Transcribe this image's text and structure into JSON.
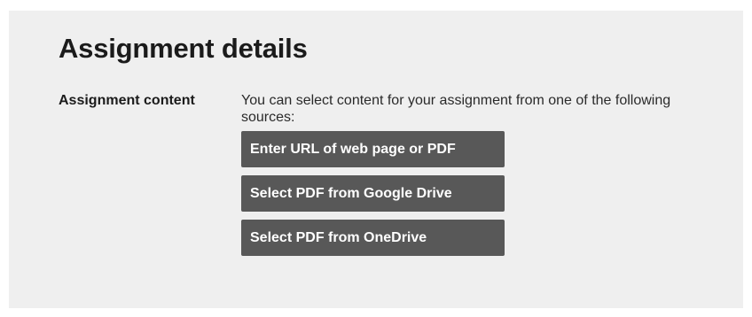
{
  "page": {
    "title": "Assignment details"
  },
  "assignment_content": {
    "label": "Assignment content",
    "description": "You can select content for your assignment from one of the following sources:",
    "buttons": [
      {
        "label": "Enter URL of web page or PDF"
      },
      {
        "label": "Select PDF from Google Drive"
      },
      {
        "label": "Select PDF from OneDrive"
      }
    ]
  },
  "colors": {
    "panel_background": "#efefef",
    "button_background": "#585858",
    "button_text": "#ffffff",
    "text": "#1b1b1b"
  }
}
